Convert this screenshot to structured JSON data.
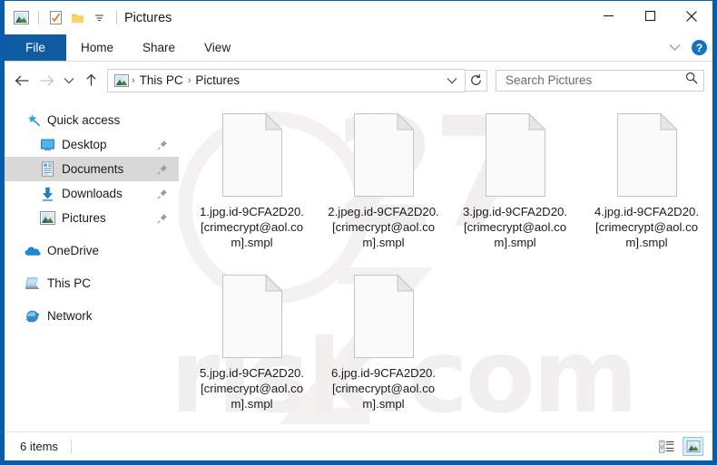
{
  "window": {
    "title": "Pictures",
    "quick_access_toolbar": [
      {
        "name": "pictures-icon",
        "label": "Pictures"
      },
      {
        "name": "properties-icon",
        "label": "Properties"
      },
      {
        "name": "new-folder-icon",
        "label": "New folder"
      },
      {
        "name": "customize-qat-icon",
        "label": "Customize Quick Access Toolbar"
      }
    ],
    "controls": {
      "minimize": "–",
      "maximize": "□",
      "close": "✕"
    }
  },
  "ribbon": {
    "tabs": [
      {
        "label": "File",
        "selected": true
      },
      {
        "label": "Home",
        "selected": false
      },
      {
        "label": "Share",
        "selected": false
      },
      {
        "label": "View",
        "selected": false
      }
    ],
    "expand_label": "Expand the Ribbon",
    "help_label": "?"
  },
  "navigation": {
    "back_label": "Back",
    "forward_label": "Forward",
    "recent_label": "Recent locations",
    "up_label": "Up",
    "refresh_label": "Refresh",
    "breadcrumb": [
      "This PC",
      "Pictures"
    ],
    "breadcrumb_separator": "›",
    "address_dropdown": "Previous locations"
  },
  "search": {
    "placeholder": "Search Pictures",
    "value": "",
    "icon": "search-icon"
  },
  "sidebar": {
    "items": [
      {
        "label": "Quick access",
        "icon": "star-pin-icon",
        "indent": false,
        "pinned": false,
        "selected": false
      },
      {
        "label": "Desktop",
        "icon": "desktop-icon",
        "indent": true,
        "pinned": true,
        "selected": false
      },
      {
        "label": "Documents",
        "icon": "documents-icon",
        "indent": true,
        "pinned": true,
        "selected": true
      },
      {
        "label": "Downloads",
        "icon": "downloads-icon",
        "indent": true,
        "pinned": true,
        "selected": false
      },
      {
        "label": "Pictures",
        "icon": "pictures-icon",
        "indent": true,
        "pinned": true,
        "selected": false
      },
      {
        "label": "OneDrive",
        "icon": "onedrive-icon",
        "indent": false,
        "pinned": false,
        "selected": false
      },
      {
        "label": "This PC",
        "icon": "this-pc-icon",
        "indent": false,
        "pinned": false,
        "selected": false
      },
      {
        "label": "Network",
        "icon": "network-icon",
        "indent": false,
        "pinned": false,
        "selected": false
      }
    ]
  },
  "files": [
    {
      "name": "1.jpg.id-9CFA2D20.[crimecrypt@aol.com].smpl",
      "icon": "blank-file-icon"
    },
    {
      "name": "2.jpeg.id-9CFA2D20.[crimecrypt@aol.com].smpl",
      "icon": "blank-file-icon"
    },
    {
      "name": "3.jpg.id-9CFA2D20.[crimecrypt@aol.com].smpl",
      "icon": "blank-file-icon"
    },
    {
      "name": "4.jpg.id-9CFA2D20.[crimecrypt@aol.com].smpl",
      "icon": "blank-file-icon"
    },
    {
      "name": "5.jpg.id-9CFA2D20.[crimecrypt@aol.com].smpl",
      "icon": "blank-file-icon"
    },
    {
      "name": "6.jpg.id-9CFA2D20.[crimecrypt@aol.com].smpl",
      "icon": "blank-file-icon"
    }
  ],
  "statusbar": {
    "item_count": "6 items",
    "views": [
      {
        "name": "details-view-button",
        "active": false
      },
      {
        "name": "large-icons-view-button",
        "active": true
      }
    ]
  },
  "watermark": {
    "text": "pcrisk.com"
  },
  "colors": {
    "window_border": "#0a5ca8",
    "file_tab": "#0f5ca3",
    "selection": "#d8d8d8",
    "view_active_border": "#8ec7ef",
    "view_active_fill": "#daeefc",
    "help_blue": "#1673c4"
  }
}
